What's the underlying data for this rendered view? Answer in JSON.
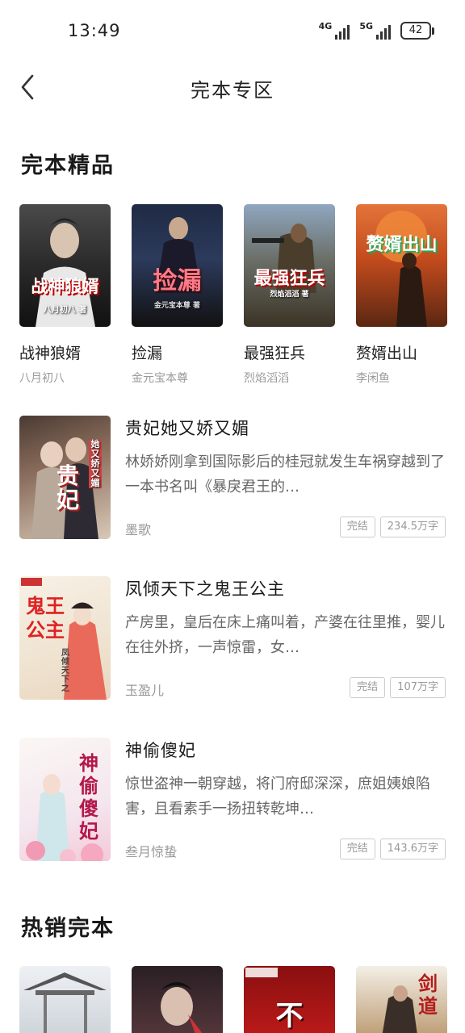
{
  "status_bar": {
    "time": "13:49",
    "network1": "4G",
    "network2": "5G",
    "battery": "42"
  },
  "nav": {
    "title": "完本专区"
  },
  "sections": {
    "featured_title": "完本精品",
    "hot_title": "热销完本"
  },
  "grid_books": [
    {
      "title": "战神狼婿",
      "author": "八月初八",
      "cover_text": "战神狼婿",
      "cover_sub": "八月初八 著"
    },
    {
      "title": "捡漏",
      "author": "金元宝本尊",
      "cover_text": "捡漏",
      "cover_sub": "金元宝本尊 著"
    },
    {
      "title": "最强狂兵",
      "author": "烈焰滔滔",
      "cover_text": "最强狂兵",
      "cover_sub": "烈焰滔滔 著"
    },
    {
      "title": "赘婿出山",
      "author": "李闲鱼",
      "cover_text": "赘婿出山",
      "cover_sub": ""
    }
  ],
  "list_books": [
    {
      "title": "贵妃她又娇又媚",
      "desc": "林娇娇刚拿到国际影后的桂冠就发生车祸穿越到了一本书名叫《暴戾君王的…",
      "author": "墨歌",
      "status": "完结",
      "words": "234.5万字",
      "cover_text": "贵妃",
      "cover_sub": "她又娇又媚"
    },
    {
      "title": "凤倾天下之鬼王公主",
      "desc": "产房里，皇后在床上痛叫着，产婆在往里推，婴儿在往外挤，一声惊雷，女…",
      "author": "玉盈儿",
      "status": "完结",
      "words": "107万字",
      "cover_text": "鬼王公主",
      "cover_sub": "凤倾天下之"
    },
    {
      "title": "神偷傻妃",
      "desc": "惊世盗神一朝穿越，将门府邸深深，庶姐姨娘陷害，且看素手一扬扭转乾坤…",
      "author": "叁月惊蛰",
      "status": "完结",
      "words": "143.6万字",
      "cover_text": "神偷傻妃",
      "cover_sub": ""
    }
  ],
  "hot_books": [
    {
      "cover_text": ""
    },
    {
      "cover_text": ""
    },
    {
      "cover_text": "不"
    },
    {
      "cover_text": "剑道"
    }
  ],
  "colors": {
    "accent_text": "#222222",
    "muted_text": "#999999",
    "desc_text": "#666666",
    "tag_border": "#cccccc"
  }
}
